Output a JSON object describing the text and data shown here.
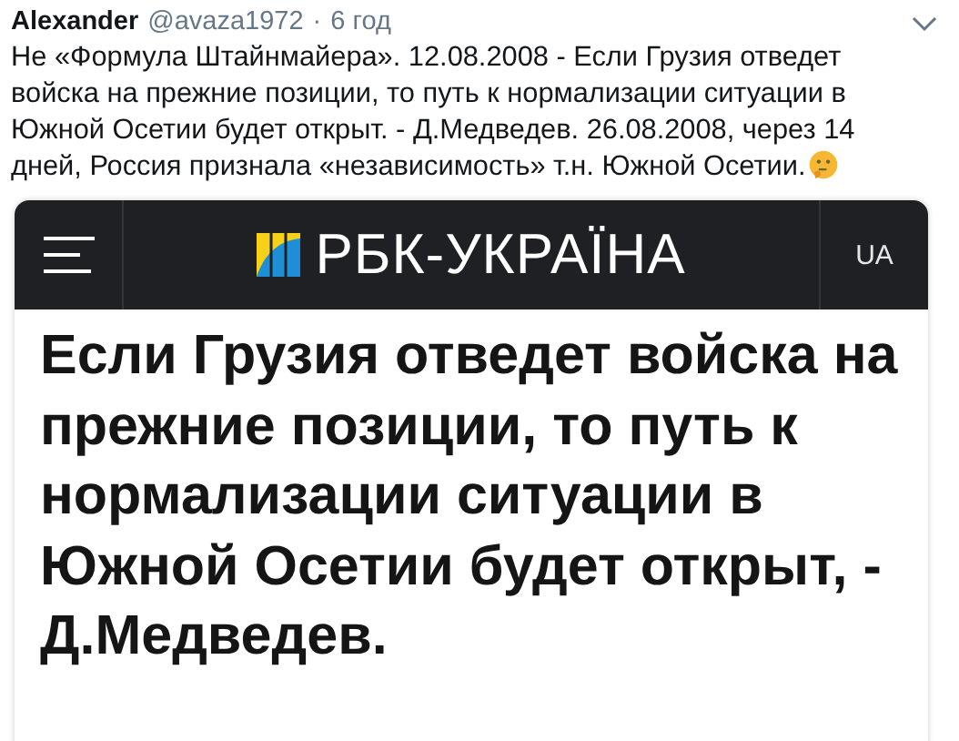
{
  "tweet": {
    "author": "Alexander",
    "handle": "@avaza1972",
    "separator": "·",
    "time": "6 год",
    "text": "Не «Формула Штайнмайера». 12.08.2008 - Если Грузия отведет войска на прежние позиции, то путь к нормализации ситуации в Южной Осетии будет открыт. - Д.Медведев. 26.08.2008, через 14 дней, Россия признала «независимость» т.н. Южной Осетии.",
    "embed": {
      "site": {
        "logo_text": "РБК-УКРАЇНА",
        "language": "UA"
      },
      "headline": "Если Грузия отведет войска на прежние позиции, то путь к нормализации ситуации в Южной Осетии будет открыт, - Д.Медведев."
    }
  }
}
